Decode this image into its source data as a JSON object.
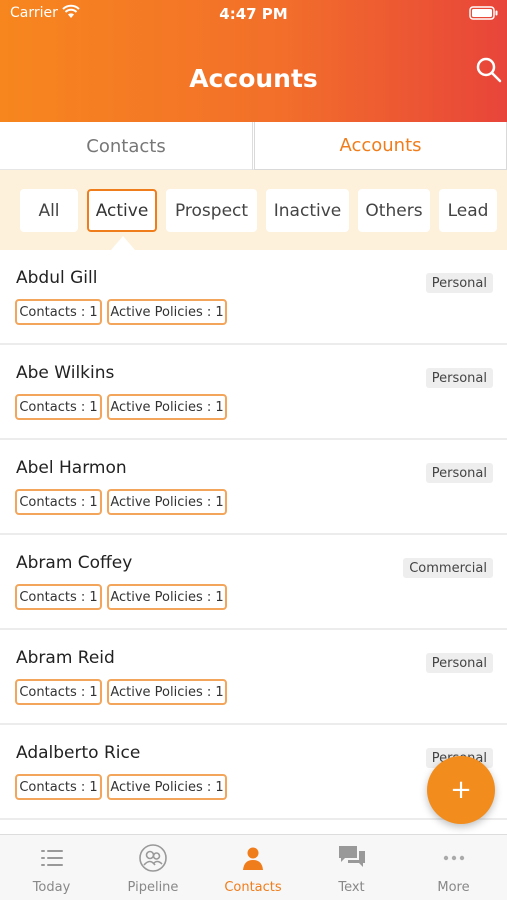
{
  "status_bar": {
    "carrier": "Carrier",
    "time": "4:47 PM"
  },
  "header": {
    "title": "Accounts",
    "search_icon": "search-icon"
  },
  "segments": {
    "contacts": "Contacts",
    "accounts": "Accounts",
    "selected": "Accounts"
  },
  "filters": {
    "items": [
      "All",
      "Active",
      "Prospect",
      "Inactive",
      "Others",
      "Lead"
    ],
    "selected": "Active"
  },
  "accounts": [
    {
      "name": "Abdul Gill",
      "type": "Personal",
      "contacts": "Contacts : 1",
      "policies": "Active Policies : 1"
    },
    {
      "name": "Abe Wilkins",
      "type": "Personal",
      "contacts": "Contacts : 1",
      "policies": "Active Policies : 1"
    },
    {
      "name": "Abel Harmon",
      "type": "Personal",
      "contacts": "Contacts : 1",
      "policies": "Active Policies : 1"
    },
    {
      "name": "Abram Coffey",
      "type": "Commercial",
      "contacts": "Contacts : 1",
      "policies": "Active Policies : 1"
    },
    {
      "name": "Abram Reid",
      "type": "Personal",
      "contacts": "Contacts : 1",
      "policies": "Active Policies : 1"
    },
    {
      "name": "Adalberto Rice",
      "type": "Personal",
      "contacts": "Contacts : 1",
      "policies": "Active Policies : 1"
    }
  ],
  "fab": {
    "label": "+"
  },
  "tabbar": {
    "items": [
      {
        "label": "Today",
        "icon": "list-icon"
      },
      {
        "label": "Pipeline",
        "icon": "people-circle-icon"
      },
      {
        "label": "Contacts",
        "icon": "person-icon"
      },
      {
        "label": "Text",
        "icon": "chat-bubbles-icon"
      },
      {
        "label": "More",
        "icon": "more-dots-icon"
      }
    ],
    "selected": "Contacts"
  },
  "colors": {
    "accent": "#f07d1c",
    "header_start": "#f7861e",
    "header_end": "#e8453a",
    "filter_bg": "#fdf1db"
  }
}
